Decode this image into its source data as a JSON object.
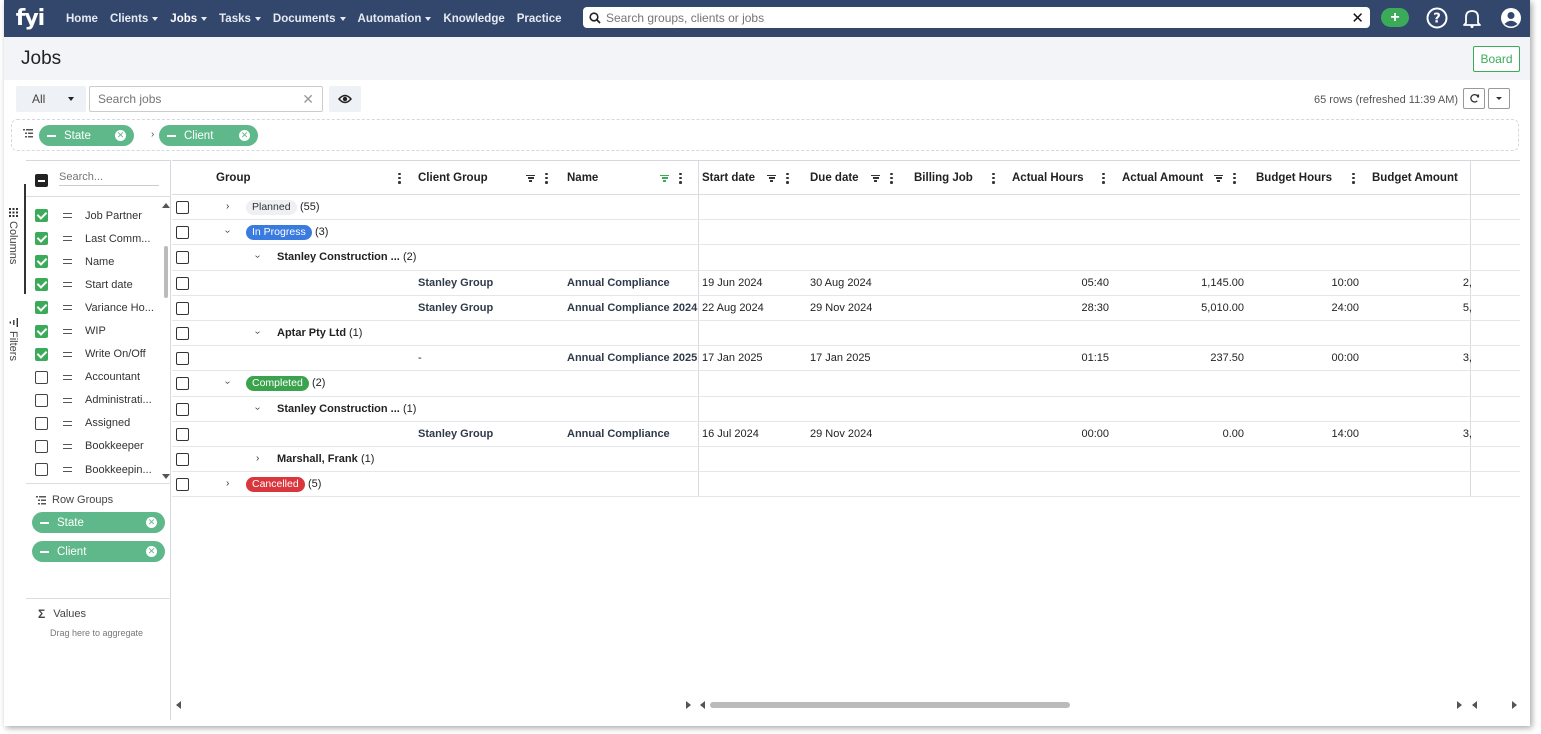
{
  "nav": {
    "logo": "fyi",
    "items": [
      {
        "label": "Home",
        "dropdown": false
      },
      {
        "label": "Clients",
        "dropdown": true
      },
      {
        "label": "Jobs",
        "dropdown": true,
        "active": true
      },
      {
        "label": "Tasks",
        "dropdown": true
      },
      {
        "label": "Documents",
        "dropdown": true
      },
      {
        "label": "Automation",
        "dropdown": true
      },
      {
        "label": "Knowledge",
        "dropdown": false
      },
      {
        "label": "Practice",
        "dropdown": false
      }
    ],
    "search_placeholder": "Search groups, clients or jobs",
    "add_label": "+"
  },
  "page": {
    "title": "Jobs",
    "board_label": "Board"
  },
  "toolbar": {
    "filter_value": "All",
    "search_placeholder": "Search jobs",
    "rows_info": "65 rows  (refreshed 11:39 AM)"
  },
  "group_bar": {
    "pills": [
      "State",
      "Client"
    ]
  },
  "side_tabs": {
    "columns": "Columns",
    "filters": "Filters"
  },
  "tool_panel": {
    "search_placeholder": "Search...",
    "columns": [
      {
        "label": "Job Partner",
        "checked": true
      },
      {
        "label": "Last Comm...",
        "checked": true
      },
      {
        "label": "Name",
        "checked": true
      },
      {
        "label": "Start date",
        "checked": true
      },
      {
        "label": "Variance Ho...",
        "checked": true
      },
      {
        "label": "WIP",
        "checked": true
      },
      {
        "label": "Write On/Off",
        "checked": true
      },
      {
        "label": "Accountant",
        "checked": false
      },
      {
        "label": "Administrati...",
        "checked": false
      },
      {
        "label": "Assigned",
        "checked": false
      },
      {
        "label": "Bookkeeper",
        "checked": false
      },
      {
        "label": "Bookkeepin...",
        "checked": false
      }
    ],
    "row_groups_title": "Row Groups",
    "row_groups": [
      "State",
      "Client"
    ],
    "values_title": "Values",
    "values_hint": "Drag here to aggregate"
  },
  "grid": {
    "columns": {
      "group": "Group",
      "client_group": "Client Group",
      "name": "Name",
      "start_date": "Start date",
      "due_date": "Due date",
      "billing_job": "Billing Job",
      "actual_hours": "Actual Hours",
      "actual_amount": "Actual Amount",
      "budget_hours": "Budget Hours",
      "budget_amount": "Budget Amount"
    },
    "rows": [
      {
        "kind": "state",
        "level": 0,
        "expanded": false,
        "badge": "planned",
        "label": "Planned",
        "count": "(55)"
      },
      {
        "kind": "state",
        "level": 0,
        "expanded": true,
        "badge": "inprog",
        "label": "In Progress",
        "count": "(3)"
      },
      {
        "kind": "client",
        "level": 1,
        "expanded": true,
        "label": "Stanley Construction ...",
        "count": "(2)"
      },
      {
        "kind": "leaf",
        "client_group": "Stanley Group",
        "name": "Annual Compliance",
        "start_date": "19 Jun 2024",
        "due_date": "30 Aug 2024",
        "billing_job": "",
        "actual_hours": "05:40",
        "actual_amount": "1,145.00",
        "budget_hours": "10:00",
        "budget_amount": "2,"
      },
      {
        "kind": "leaf",
        "client_group": "Stanley Group",
        "name": "Annual Compliance 2024",
        "start_date": "22 Aug 2024",
        "due_date": "29 Nov 2024",
        "billing_job": "",
        "actual_hours": "28:30",
        "actual_amount": "5,010.00",
        "budget_hours": "24:00",
        "budget_amount": "5,"
      },
      {
        "kind": "client",
        "level": 1,
        "expanded": true,
        "label": "Aptar Pty Ltd",
        "count": "(1)"
      },
      {
        "kind": "leaf",
        "client_group": "-",
        "name": "Annual Compliance 2025",
        "start_date": "17 Jan 2025",
        "due_date": "17 Jan 2025",
        "billing_job": "",
        "actual_hours": "01:15",
        "actual_amount": "237.50",
        "budget_hours": "00:00",
        "budget_amount": "3,"
      },
      {
        "kind": "state",
        "level": 0,
        "expanded": true,
        "badge": "completed",
        "label": "Completed",
        "count": "(2)"
      },
      {
        "kind": "client",
        "level": 1,
        "expanded": true,
        "label": "Stanley Construction ...",
        "count": "(1)"
      },
      {
        "kind": "leaf",
        "client_group": "Stanley Group",
        "name": "Annual Compliance",
        "start_date": "16 Jul 2024",
        "due_date": "29 Nov 2024",
        "billing_job": "",
        "actual_hours": "00:00",
        "actual_amount": "0.00",
        "budget_hours": "14:00",
        "budget_amount": "3,"
      },
      {
        "kind": "client",
        "level": 1,
        "expanded": false,
        "label": "Marshall, Frank",
        "count": "(1)"
      },
      {
        "kind": "state",
        "level": 0,
        "expanded": false,
        "badge": "cancelled",
        "label": "Cancelled",
        "count": "(5)"
      }
    ]
  },
  "colors": {
    "nav_bg": "#33466b",
    "accent_green": "#3bab5a",
    "pill_green": "#5fb88a",
    "in_progress": "#3a7be0",
    "completed": "#3ba34e",
    "cancelled": "#d9363e"
  }
}
